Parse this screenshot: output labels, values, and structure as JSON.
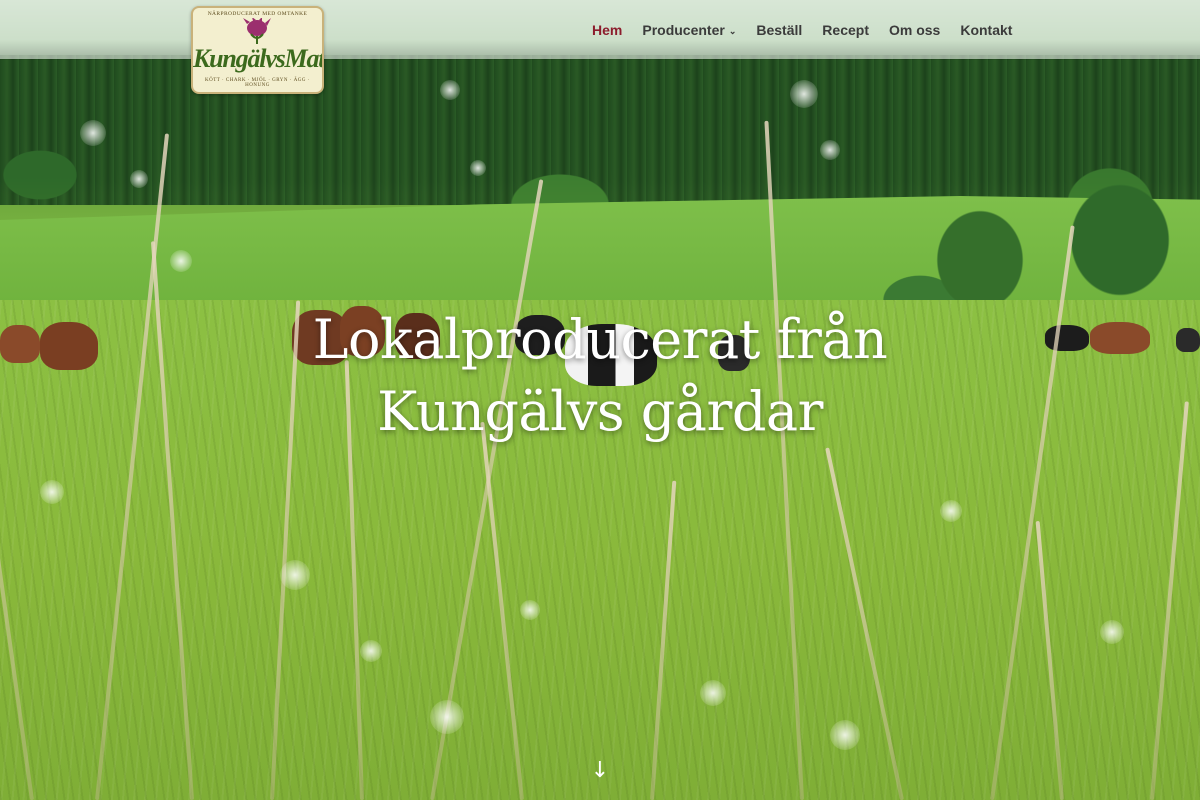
{
  "logo": {
    "arc_text": "NÄRPRODUCERAT MED OMTANKE",
    "title": "KungälvsMat",
    "subtitle": "KÖTT · CHARK · MJÖL · GRYN · ÄGG · HONUNG",
    "flower_color": "#9b2f6e",
    "title_color": "#3c6a1d"
  },
  "nav": {
    "items": [
      {
        "label": "Hem",
        "active": true
      },
      {
        "label": "Producenter",
        "dropdown": true
      },
      {
        "label": "Beställ"
      },
      {
        "label": "Recept"
      },
      {
        "label": "Om oss"
      },
      {
        "label": "Kontakt"
      }
    ],
    "active_color": "#8c1c2c",
    "dropdown_icon": "chevron-down-icon"
  },
  "hero": {
    "headline_line1": "Lokalproducerat från",
    "headline_line2": "Kungälvs gårdar",
    "scroll_icon": "arrow-down-icon",
    "scroll_glyph": "↓"
  }
}
